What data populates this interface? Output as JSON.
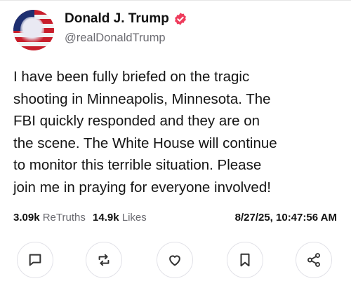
{
  "author": {
    "display_name": "Donald J. Trump",
    "handle": "@realDonaldTrump",
    "verified": true,
    "badge_color": "#ee3c5c"
  },
  "post": {
    "lines": [
      "I have been fully briefed on the tragic",
      "shooting in Minneapolis, Minnesota. The",
      "FBI quickly responded and they are on",
      "the scene. The White House will continue",
      "to monitor this terrible situation. Please",
      "join me in praying for everyone involved!"
    ]
  },
  "stats": {
    "retruths_count": "3.09k",
    "retruths_label": "ReTruths",
    "likes_count": "14.9k",
    "likes_label": "Likes",
    "timestamp": "8/27/25, 10:47:56 AM"
  },
  "actions": [
    {
      "icon": "comment-icon"
    },
    {
      "icon": "retruth-icon"
    },
    {
      "icon": "heart-icon"
    },
    {
      "icon": "bookmark-icon"
    },
    {
      "icon": "share-icon"
    }
  ]
}
